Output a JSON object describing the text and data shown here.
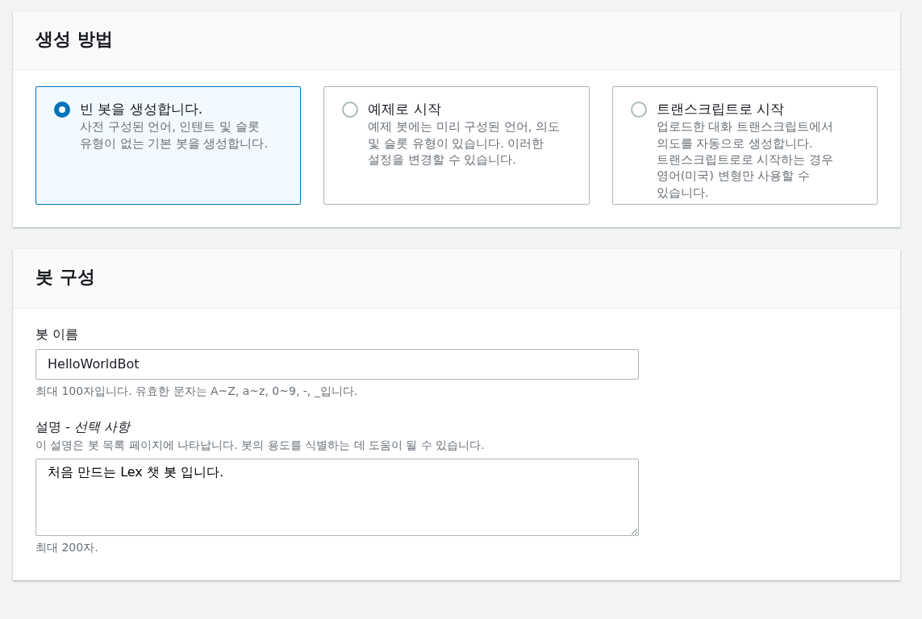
{
  "creation_method": {
    "title": "생성 방법",
    "options": [
      {
        "label": "빈 봇을 생성합니다.",
        "description": "사전 구성된 언어, 인텐트 및 슬롯 유형이 없는 기본 봇을 생성합니다.",
        "selected": true
      },
      {
        "label": "예제로 시작",
        "description": "예제 봇에는 미리 구성된 언어, 의도 및 슬롯 유형이 있습니다. 이러한 설정을 변경할 수 있습니다.",
        "selected": false
      },
      {
        "label": "트랜스크립트로 시작",
        "description": "업로드한 대화 트랜스크립트에서 의도를 자동으로 생성합니다. 트랜스크립트로로 시작하는 경우 영어(미국) 변형만 사용할 수 있습니다.",
        "selected": false
      }
    ]
  },
  "bot_configuration": {
    "title": "봇 구성",
    "bot_name": {
      "label": "봇 이름",
      "value": "HelloWorldBot",
      "hint": "최대 100자입니다. 유효한 문자는 A~Z, a~z, 0~9, -, _입니다."
    },
    "description": {
      "label": "설명 - *선택 사항*",
      "help": "이 설명은 봇 목록 페이지에 나타납니다. 봇의 용도를 식별하는 데 도움이 될 수 있습니다.",
      "value": "처음 만드는 Lex 챗 봇 입니다.",
      "hint": "최대 200자."
    }
  }
}
